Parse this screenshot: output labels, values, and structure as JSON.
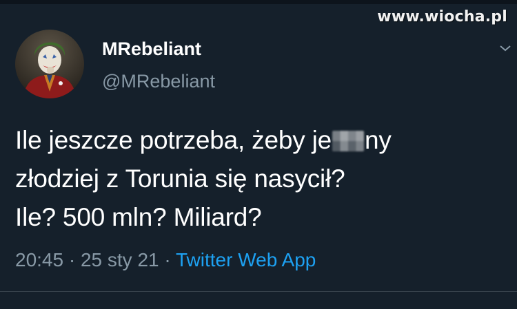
{
  "watermark": "www.wiocha.pl",
  "tweet": {
    "display_name": "MRebeliant",
    "handle": "@MRebeliant",
    "text_lines": {
      "line1_before": "Ile jeszcze potrzeba, żeby je",
      "line1_after": "ny",
      "line2": "złodziej z Torunia się nasycił?",
      "line3": "Ile? 500 mln? Miliard?"
    },
    "time": "20:45",
    "separator": "·",
    "date": "25 sty 21",
    "source": "Twitter Web App"
  },
  "colors": {
    "background": "#15202b",
    "text": "#ffffff",
    "secondary": "#8899a6",
    "link": "#1da1f2"
  },
  "icons": {
    "menu": "chevron-down-icon",
    "avatar": "joker-avatar",
    "censor": "pixelated-censor"
  }
}
